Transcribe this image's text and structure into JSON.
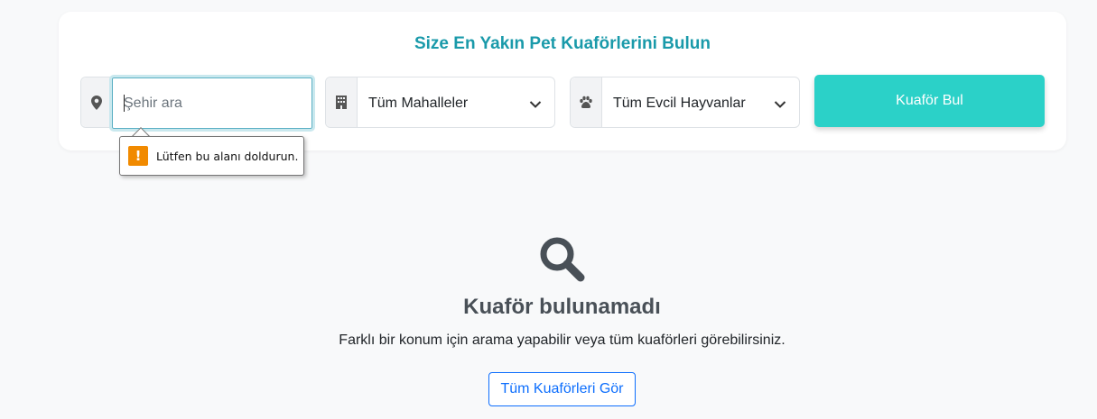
{
  "search": {
    "title": "Size En Yakın Pet Kuaförlerini Bulun",
    "city_placeholder": "Şehir ara",
    "neighborhood_selected": "Tüm Mahalleler",
    "pet_selected": "Tüm Evcil Hayvanlar",
    "find_button_label": "Kuaför Bul",
    "location_icon": "map-pin-icon",
    "building_icon": "building-icon",
    "paw_icon": "paw-icon"
  },
  "validation": {
    "message": "Lütfen bu alanı doldurun.",
    "icon_glyph": "!"
  },
  "empty_state": {
    "icon": "search-icon",
    "title": "Kuaför bulunamadı",
    "description": "Farklı bir konum için arama yapabilir veya tüm kuaförleri görebilirsiniz.",
    "button_label": "Tüm Kuaförleri Gör"
  },
  "colors": {
    "title": "#1a9aaa",
    "primary_button": "#2bd1c8",
    "outline_button": "#0d6efd",
    "warning": "#f18a00"
  }
}
